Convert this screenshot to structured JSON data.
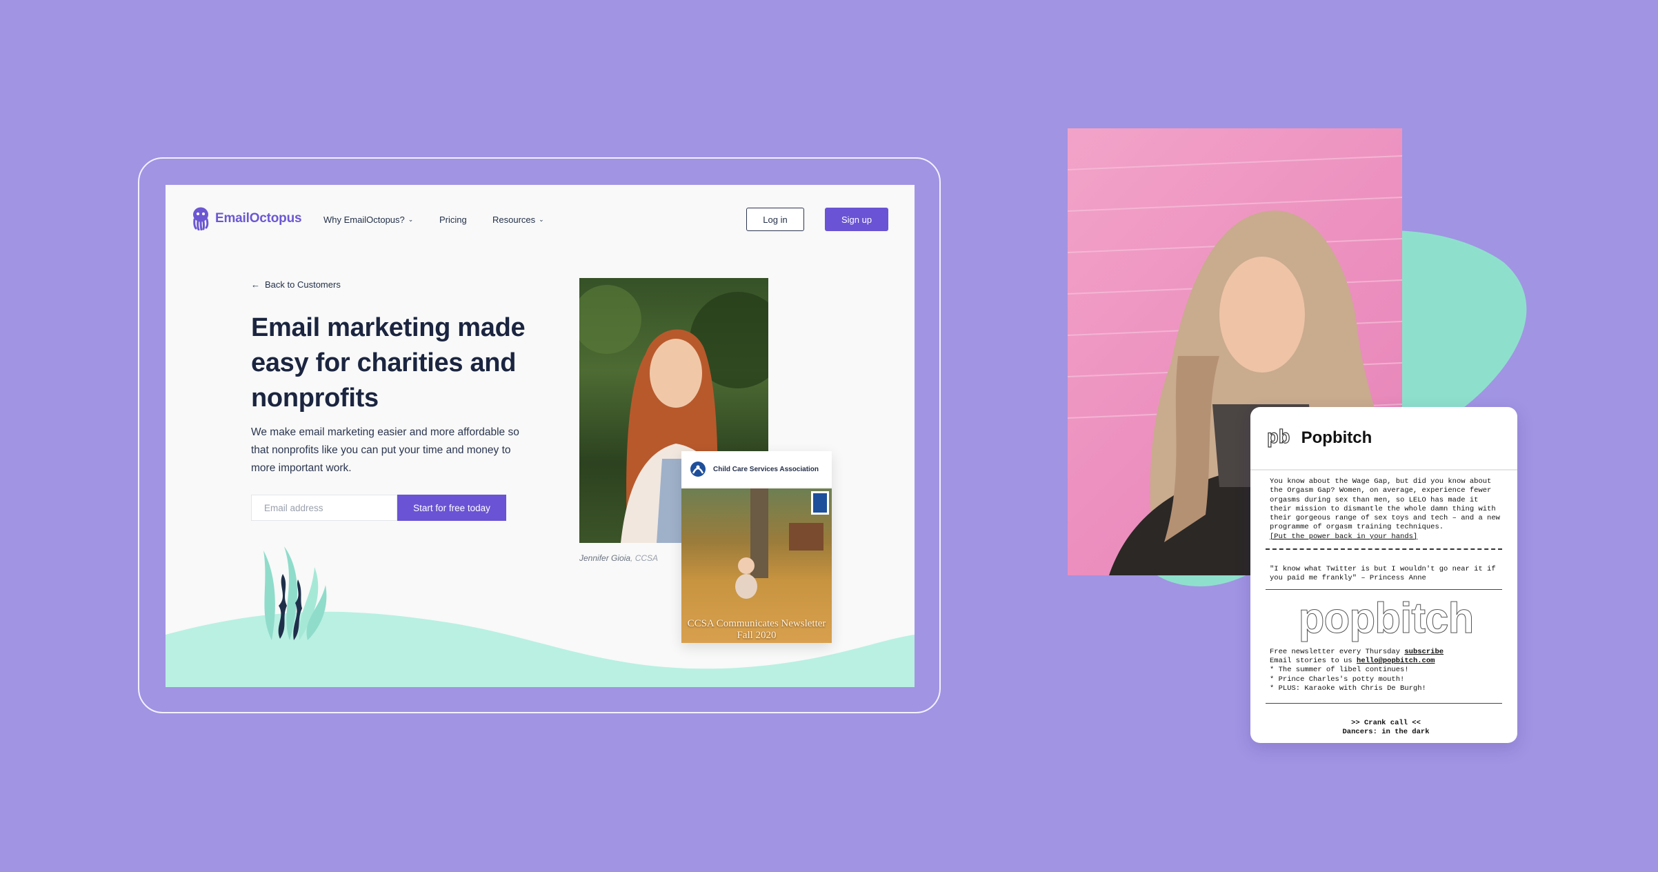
{
  "colors": {
    "background": "#a194e3",
    "brand_purple": "#6a53d4",
    "mint": "#b9f0e2",
    "teal_blob": "#8ee0cc",
    "headline": "#1b2540"
  },
  "emailoctopus": {
    "logo_text": "EmailOctopus",
    "logo_icon": "octopus-icon",
    "nav": [
      {
        "label": "Why EmailOctopus?",
        "has_dropdown": true
      },
      {
        "label": "Pricing",
        "has_dropdown": false
      },
      {
        "label": "Resources",
        "has_dropdown": true
      }
    ],
    "login_label": "Log in",
    "signup_label": "Sign up",
    "back_link": "Back to Customers",
    "headline": "Email marketing made easy for charities and nonprofits",
    "subtext": "We make email marketing easier and more affordable so that nonprofits like you can put your time and money to more important work.",
    "email_placeholder": "Email address",
    "cta_label": "Start for free today",
    "caption_name": "Jennifer Gioia",
    "caption_org": ", CCSA",
    "newsletter": {
      "org": "Child Care Services Association",
      "title_line1": "CCSA Communicates Newsletter",
      "title_line2": "Fall 2020"
    }
  },
  "popbitch": {
    "logo": "pb",
    "title": "Popbitch",
    "intro": "You know about the Wage Gap, but did you know about the Orgasm Gap? Women, on average, experience fewer orgasms during sex than men, so LELO has made it their mission to dismantle the whole damn thing with their gorgeous range of sex toys and tech – and a new programme of orgasm training techniques.",
    "intro_link": "[Put the power back in your hands]",
    "quote": "\"I know what Twitter is but I wouldn't go near it if you paid me frankly\" – Princess Anne",
    "ascii_logo": "popbitch",
    "free_line": "Free newsletter every Thursday ",
    "subscribe_link": "subscribe",
    "email_line": "Email stories to us ",
    "email_link": "hello@popbitch.com",
    "bullets": [
      "* The summer of libel continues!",
      "* Prince Charles's potty mouth!",
      "* PLUS: Karaoke with Chris De Burgh!"
    ],
    "section_1": ">> Crank call <<",
    "section_2": "Dancers: in the dark"
  }
}
